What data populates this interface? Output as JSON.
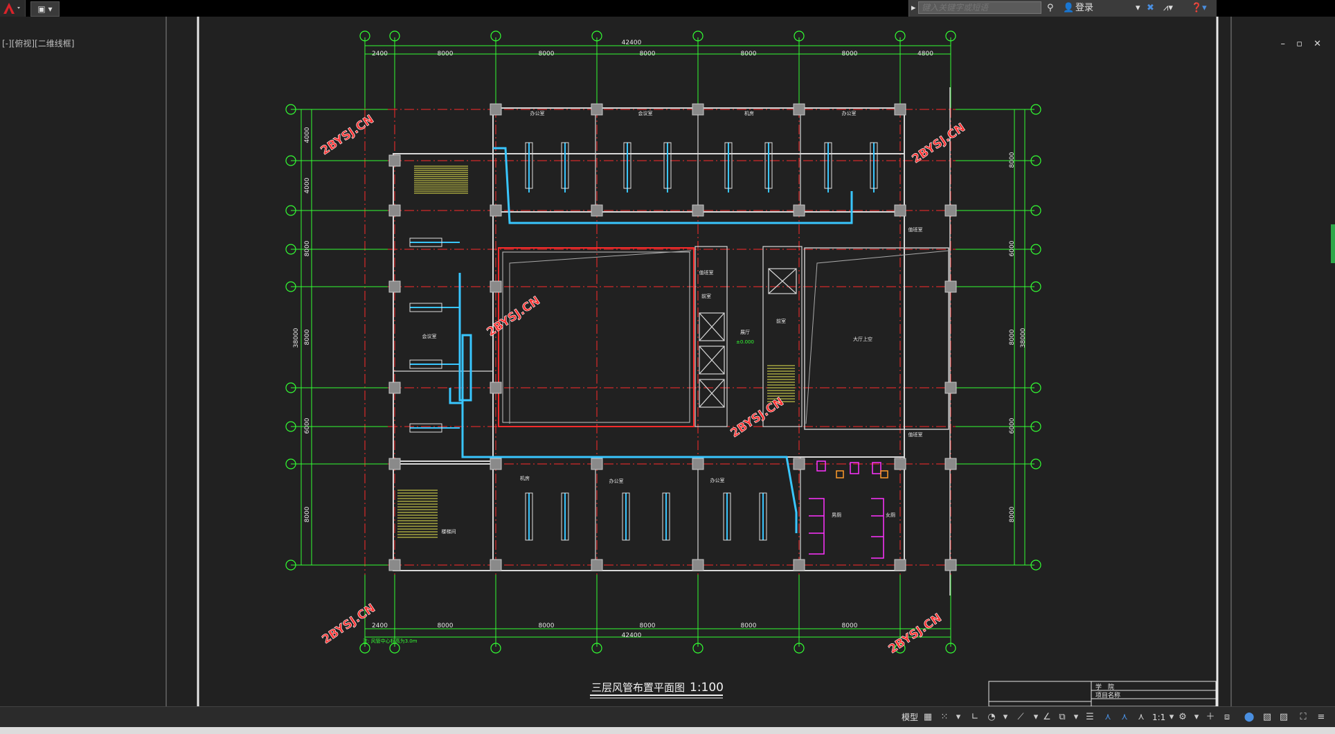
{
  "app": {
    "quick_access_icon": "document-save-icon",
    "search_placeholder": "键入关键字或短语",
    "login_label": "登录",
    "view_label": "[-][俯视][二维线框]",
    "window_controls": "– ▫ ✕"
  },
  "drawing": {
    "title": "三层风管布置平面图",
    "scale": "1:100",
    "total_dimension": "42400",
    "bay_dims_top": [
      "2400",
      "8000",
      "8000",
      "8000",
      "8000",
      "8000",
      "4800"
    ],
    "bay_dims_bottom": [
      "2400",
      "8000",
      "8000",
      "8000",
      "8000",
      "8000"
    ],
    "left_dims": [
      "4000",
      "4000",
      "8000",
      "8000",
      "6000",
      "8000"
    ],
    "left_total": "38000",
    "right_dims": [
      "8000",
      "6000",
      "8000",
      "6000",
      "8000"
    ],
    "right_total": "38000",
    "watermark": "2BYSJ.CN",
    "note": "注: 风管中心标高为3.0m",
    "room_labels": [
      "办公室",
      "会议室",
      "机房",
      "大厅上空",
      "楼梯间",
      "男厕",
      "女厕",
      "值班室",
      "前室",
      "展厅"
    ],
    "level_mark": "±0.000"
  },
  "title_block": {
    "school": "学　院",
    "project": "项目名称"
  },
  "statusbar": {
    "model_label": "模型",
    "scale_label": "1:1"
  },
  "colors": {
    "canvas": "#212121",
    "axis": "#ff2b2b",
    "dimension": "#33ff33",
    "duct": "#39c6ff",
    "wall": "#d8d8d8",
    "stair": "#e6e650",
    "toilet": "#ff33ff",
    "watermark": "#ff3030"
  }
}
